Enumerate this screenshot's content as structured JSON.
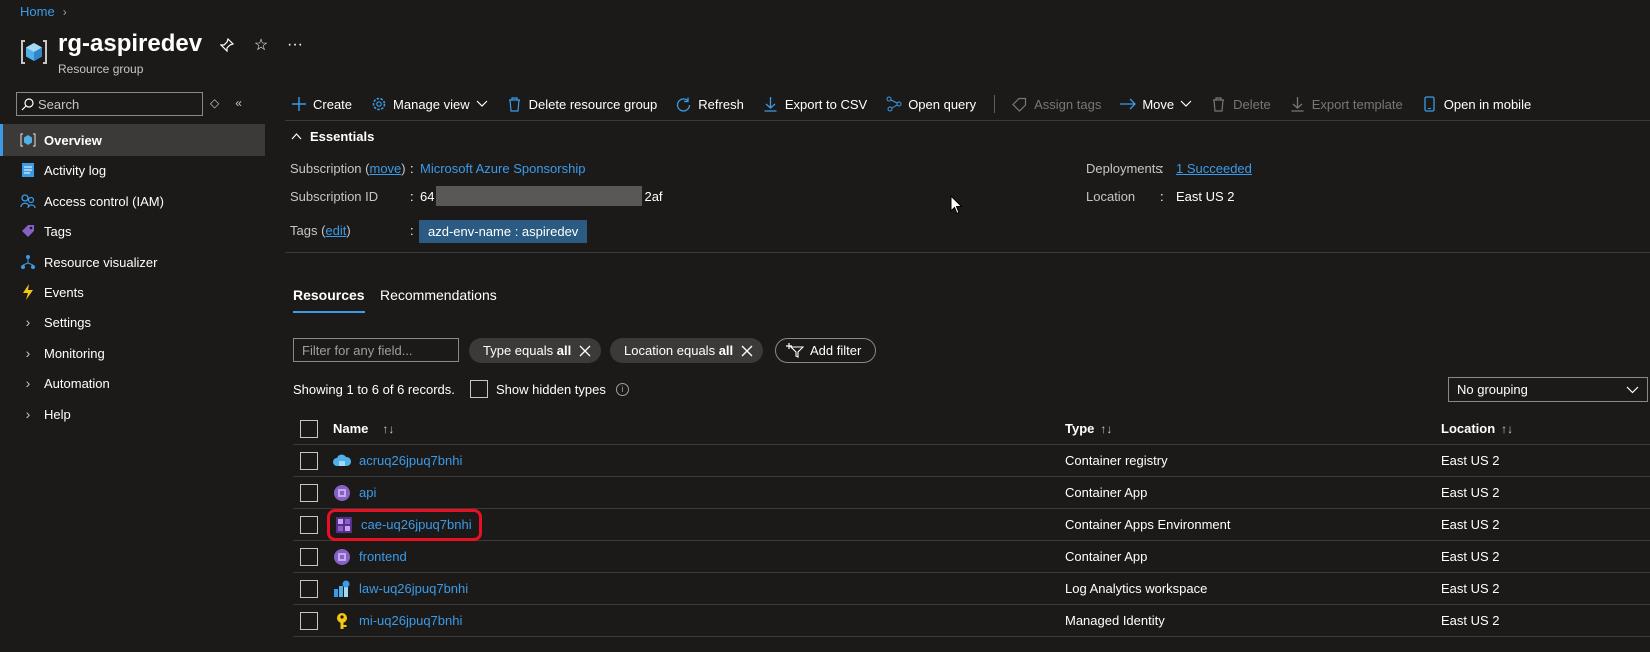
{
  "breadcrumb": {
    "home": "Home"
  },
  "header": {
    "title": "rg-aspiredev",
    "subtitle": "Resource group",
    "more": "···"
  },
  "sidebar": {
    "search_placeholder": "Search",
    "items": [
      {
        "label": "Overview",
        "icon": "overview-icon",
        "active": true
      },
      {
        "label": "Activity log",
        "icon": "activity-log-icon"
      },
      {
        "label": "Access control (IAM)",
        "icon": "iam-icon"
      },
      {
        "label": "Tags",
        "icon": "tag-icon"
      },
      {
        "label": "Resource visualizer",
        "icon": "visualizer-icon"
      },
      {
        "label": "Events",
        "icon": "lightning-icon"
      },
      {
        "label": "Settings",
        "icon": "chevron-right-icon"
      },
      {
        "label": "Monitoring",
        "icon": "chevron-right-icon"
      },
      {
        "label": "Automation",
        "icon": "chevron-right-icon"
      },
      {
        "label": "Help",
        "icon": "chevron-right-icon"
      }
    ]
  },
  "toolbar": {
    "create": "Create",
    "manage_view": "Manage view",
    "delete_rg": "Delete resource group",
    "refresh": "Refresh",
    "export_csv": "Export to CSV",
    "open_query": "Open query",
    "assign_tags": "Assign tags",
    "move": "Move",
    "delete": "Delete",
    "export_template": "Export template",
    "open_mobile": "Open in mobile"
  },
  "essentials": {
    "heading": "Essentials",
    "subscription_label": "Subscription",
    "move_link": "move",
    "subscription_value": "Microsoft Azure Sponsorship",
    "subscription_id_label": "Subscription ID",
    "subscription_id_prefix": "64",
    "subscription_id_suffix": "2af",
    "tags_label": "Tags",
    "edit_link": "edit",
    "tag_value": "azd-env-name : aspiredev",
    "deployments_label": "Deployments",
    "deployments_value": "1 Succeeded",
    "location_label": "Location",
    "location_value": "East US 2",
    "colon": ":"
  },
  "tabs": {
    "resources": "Resources",
    "recommendations": "Recommendations"
  },
  "filters": {
    "placeholder": "Filter for any field...",
    "type_prefix": "Type equals",
    "type_value": "all",
    "location_prefix": "Location equals",
    "location_value": "all",
    "add_filter": "Add filter"
  },
  "records": {
    "text": "Showing 1 to 6 of 6 records.",
    "show_hidden": "Show hidden types",
    "grouping": "No grouping"
  },
  "table": {
    "headers": {
      "name": "Name",
      "type": "Type",
      "location": "Location"
    },
    "sort_icon": "↑↓",
    "sort_asc_icon": "↑↓",
    "rows": [
      {
        "name": "acruq26jpuq7bnhi",
        "type": "Container registry",
        "location": "East US 2",
        "icon": "container-registry-icon"
      },
      {
        "name": "api",
        "type": "Container App",
        "location": "East US 2",
        "icon": "container-app-icon"
      },
      {
        "name": "cae-uq26jpuq7bnhi",
        "type": "Container Apps Environment",
        "location": "East US 2",
        "icon": "container-apps-env-icon",
        "highlighted": true
      },
      {
        "name": "frontend",
        "type": "Container App",
        "location": "East US 2",
        "icon": "container-app-icon"
      },
      {
        "name": "law-uq26jpuq7bnhi",
        "type": "Log Analytics workspace",
        "location": "East US 2",
        "icon": "log-analytics-icon"
      },
      {
        "name": "mi-uq26jpuq7bnhi",
        "type": "Managed Identity",
        "location": "East US 2",
        "icon": "managed-identity-icon"
      }
    ]
  },
  "colors": {
    "accent": "#3b9be8",
    "background": "#1b1a19",
    "highlight": "#e81123"
  }
}
